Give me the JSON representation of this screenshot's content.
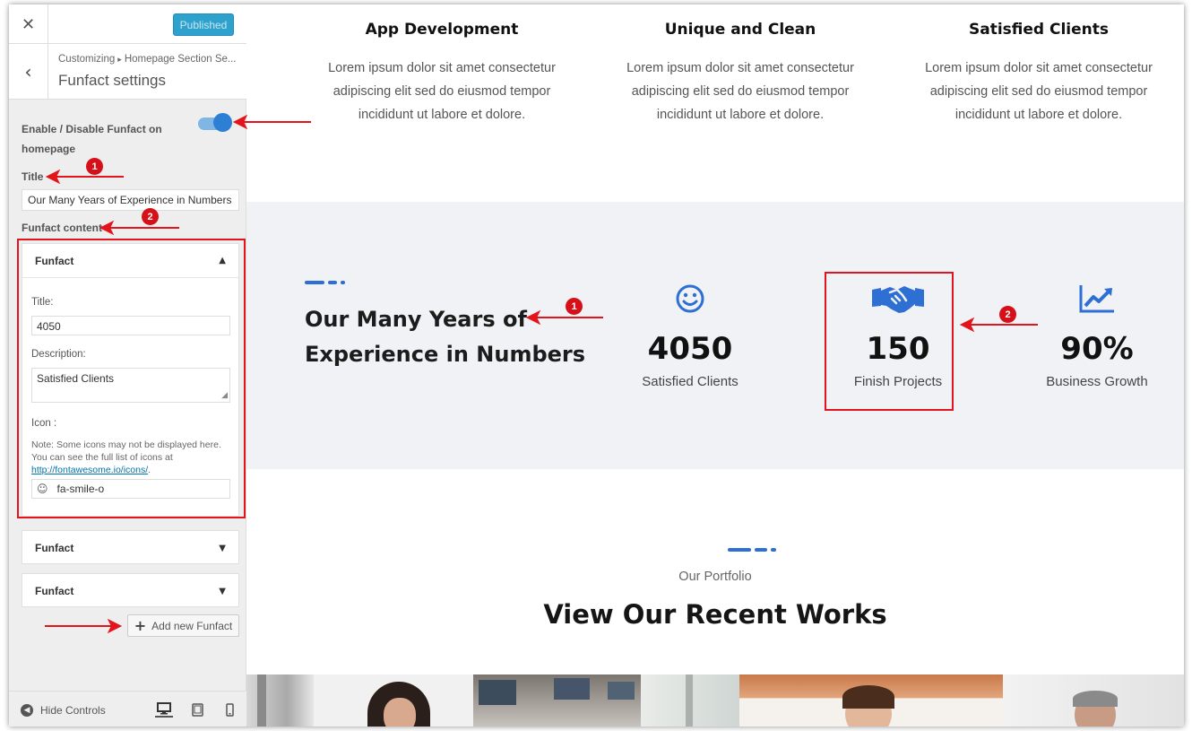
{
  "customizer": {
    "publish_label": "Published",
    "close_icon": "close-icon",
    "breadcrumb": {
      "root": "Customizing",
      "separator": "▸",
      "parent": "Homepage Section Se..."
    },
    "section_title": "Funfact settings",
    "enable_label": "Enable / Disable Funfact on homepage",
    "enable_on": true,
    "title_label": "Title",
    "title_value": "Our Many Years of Experience in Numbers",
    "content_label": "Funfact content",
    "items": [
      {
        "header": "Funfact",
        "expanded": true,
        "title_label": "Title:",
        "title_value": "4050",
        "description_label": "Description:",
        "description_value": "Satisfied Clients",
        "icon_label": "Icon :",
        "note_text": "Note: Some icons may not be displayed here. You can see the full list of icons at",
        "note_link": "http://fontawesome.io/icons/",
        "icon_value": "fa-smile-o",
        "icon_glyph": "☺"
      },
      {
        "header": "Funfact",
        "expanded": false
      },
      {
        "header": "Funfact",
        "expanded": false
      }
    ],
    "add_button_label": "Add new Funfact",
    "hide_controls_label": "Hide Controls"
  },
  "preview": {
    "services": [
      {
        "title": "App Development",
        "text": "Lorem ipsum dolor sit amet consectetur adipiscing elit sed do eiusmod tempor incididunt ut labore et dolore."
      },
      {
        "title": "Unique and Clean",
        "text": "Lorem ipsum dolor sit amet consectetur adipiscing elit sed do eiusmod tempor incididunt ut labore et dolore."
      },
      {
        "title": "Satisfied Clients",
        "text": "Lorem ipsum dolor sit amet consectetur adipiscing elit sed do eiusmod tempor incididunt ut labore et dolore."
      }
    ],
    "funfact": {
      "heading_line1": "Our Many Years of",
      "heading_line2": "Experience in Numbers",
      "stats": [
        {
          "icon": "smile-icon",
          "number": "4050",
          "caption": "Satisfied Clients"
        },
        {
          "icon": "handshake-icon",
          "number": "150",
          "caption": "Finish Projects"
        },
        {
          "icon": "chart-line-icon",
          "number": "90%",
          "caption": "Business Growth"
        }
      ]
    },
    "portfolio": {
      "subtitle": "Our Portfolio",
      "title": "View Our Recent Works"
    }
  },
  "annotations": {
    "badge_1": "1",
    "badge_2": "2"
  },
  "colors": {
    "accent": "#2d6fd3",
    "annotation_red": "#e3141c",
    "publish": "#2ea2cc",
    "funfact_bg": "#f0f2f5"
  }
}
